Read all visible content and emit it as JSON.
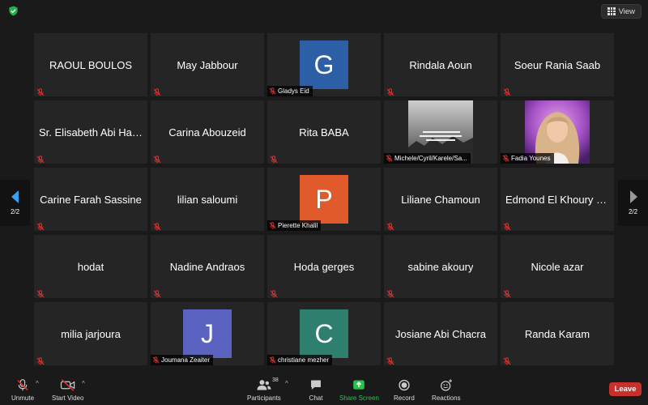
{
  "top": {
    "view_label": "View"
  },
  "pager": {
    "left_label": "2/2",
    "right_label": "2/2"
  },
  "participants": [
    {
      "name": "RAOUL BOULOS",
      "type": "text"
    },
    {
      "name": "May Jabbour",
      "type": "text"
    },
    {
      "name": "Gladys Eid",
      "type": "avatar",
      "initial": "G",
      "color": "#2d5fa7"
    },
    {
      "name": "Rindala Aoun",
      "type": "text"
    },
    {
      "name": "Soeur Rania Saab",
      "type": "text"
    },
    {
      "name": "Sr. Elisabeth Abi Hach...",
      "type": "text"
    },
    {
      "name": "Carina Abouzeid",
      "type": "text"
    },
    {
      "name": "Rita BABA",
      "type": "text"
    },
    {
      "name": "Michele/Cyril/Karele/Sa...",
      "type": "photo",
      "photo": "quote"
    },
    {
      "name": "Fadia Younes",
      "type": "photo",
      "photo": "portrait"
    },
    {
      "name": "Carine Farah Sassine",
      "type": "text"
    },
    {
      "name": "lilian saloumi",
      "type": "text"
    },
    {
      "name": "Pierette Khalil",
      "type": "avatar",
      "initial": "P",
      "color": "#e05a2b"
    },
    {
      "name": "Liliane Chamoun",
      "type": "text"
    },
    {
      "name": "Edmond El Khoury Ha...",
      "type": "text"
    },
    {
      "name": "hodat",
      "type": "text"
    },
    {
      "name": "Nadine Andraos",
      "type": "text"
    },
    {
      "name": "Hoda gerges",
      "type": "text"
    },
    {
      "name": "sabine akoury",
      "type": "text"
    },
    {
      "name": "Nicole azar",
      "type": "text"
    },
    {
      "name": "milia jarjoura",
      "type": "text"
    },
    {
      "name": "Joumana Zeaiter",
      "type": "avatar",
      "initial": "J",
      "color": "#5a64c0"
    },
    {
      "name": "christiane mezher",
      "type": "avatar",
      "initial": "C",
      "color": "#2f7f6f"
    },
    {
      "name": "Josiane Abi Chacra",
      "type": "text"
    },
    {
      "name": "Randa Karam",
      "type": "text"
    }
  ],
  "toolbar": {
    "unmute_label": "Unmute",
    "start_video_label": "Start Video",
    "participants_label": "Participants",
    "participants_count": "38",
    "chat_label": "Chat",
    "share_label": "Share Screen",
    "record_label": "Record",
    "reactions_label": "Reactions",
    "leave_label": "Leave"
  },
  "colors": {
    "share_green": "#27c24c",
    "leave_red": "#c8302c",
    "mute_red": "#e0302a"
  }
}
